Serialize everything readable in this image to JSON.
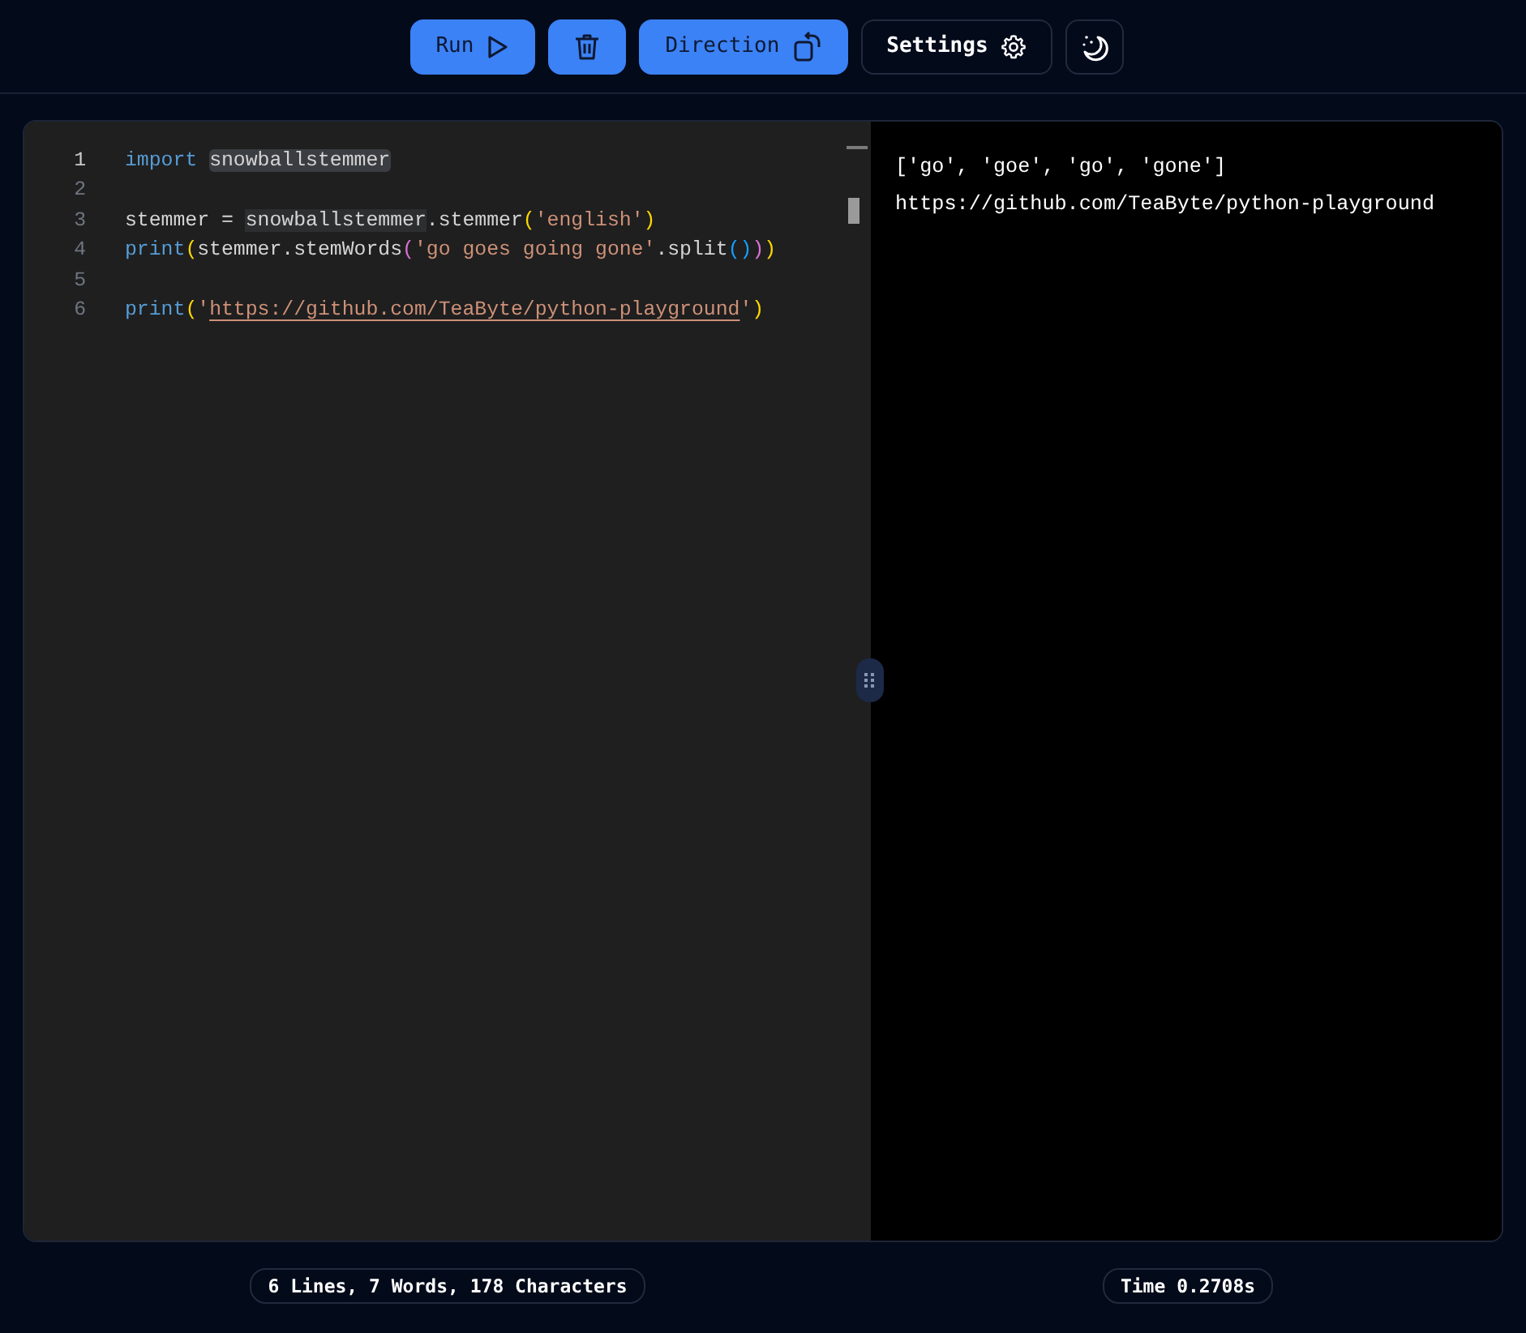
{
  "toolbar": {
    "buttons": [
      {
        "label": "Run",
        "kind": "run"
      },
      {
        "kind": "clear"
      },
      {
        "label": "Direction",
        "kind": "direction"
      },
      {
        "label": "Settings",
        "kind": "settings"
      },
      {
        "kind": "theme"
      }
    ]
  },
  "editor": {
    "lines": [
      {
        "number": "1",
        "active": true,
        "tokens": [
          {
            "text": "import ",
            "kind": "keyword"
          },
          {
            "text": "snowballstemmer",
            "kind": "selection"
          }
        ]
      },
      {
        "number": "2",
        "active": false
      },
      {
        "number": "3",
        "active": false,
        "tokens": [
          {
            "text": "stemmer = ",
            "kind": "plain"
          },
          {
            "text": "snowballstemmer",
            "kind": "match"
          },
          {
            "text": ".stemmer",
            "kind": "plain"
          },
          {
            "text": "(",
            "kind": "bracket1"
          },
          {
            "text": "'english'",
            "kind": "string"
          },
          {
            "text": ")",
            "kind": "bracket1"
          }
        ]
      },
      {
        "number": "4",
        "active": false,
        "tokens": [
          {
            "text": "print",
            "kind": "keyword"
          },
          {
            "text": "(",
            "kind": "bracket1"
          },
          {
            "text": "stemmer.stemWords",
            "kind": "plain"
          },
          {
            "text": "(",
            "kind": "bracket2"
          },
          {
            "text": "'go goes going gone'",
            "kind": "string"
          },
          {
            "text": ".split",
            "kind": "plain"
          },
          {
            "text": "()",
            "kind": "bracket3"
          },
          {
            "text": ")",
            "kind": "bracket2"
          },
          {
            "text": ")",
            "kind": "bracket1"
          }
        ]
      },
      {
        "number": "5",
        "active": false
      },
      {
        "number": "6",
        "active": false,
        "tokens": [
          {
            "text": "print",
            "kind": "keyword"
          },
          {
            "text": "(",
            "kind": "bracket1"
          },
          {
            "text": "'",
            "kind": "string"
          },
          {
            "text": "https://github.com/TeaByte/python-playground",
            "kind": "link"
          },
          {
            "text": "'",
            "kind": "string"
          },
          {
            "text": ")",
            "kind": "bracket1"
          }
        ]
      }
    ]
  },
  "output": {
    "lines": [
      "['go', 'goe', 'go', 'gone']",
      "https://github.com/TeaByte/python-playground"
    ]
  },
  "status": {
    "editor_stats": "6 Lines, 7 Words, 178 Characters",
    "time": "Time 0.2708s"
  }
}
